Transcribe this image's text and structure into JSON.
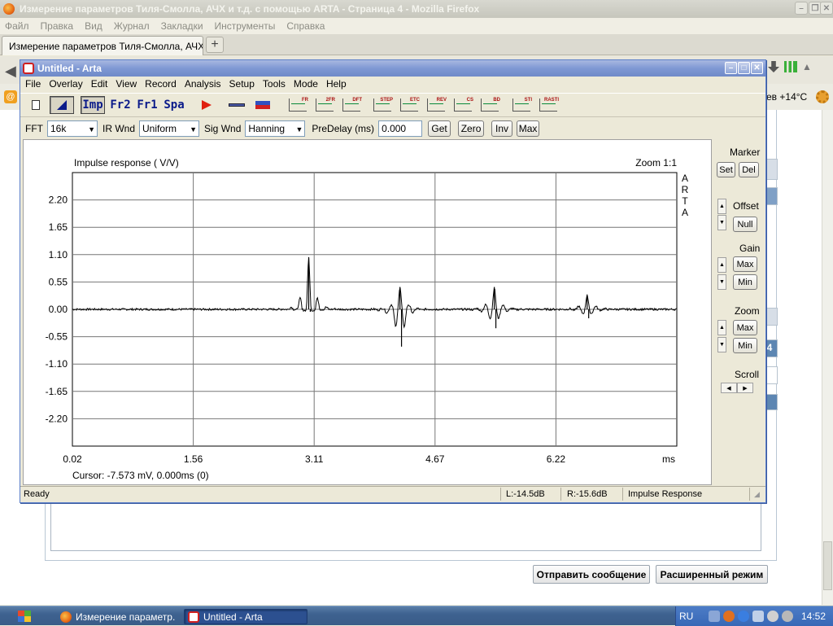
{
  "firefox": {
    "title": "Измерение параметров Тиля-Смолла, АЧХ и т.д. с помощью ARTA - Страница 4 - Mozilla Firefox",
    "menu": [
      "Файл",
      "Правка",
      "Вид",
      "Журнал",
      "Закладки",
      "Инструменты",
      "Справка"
    ],
    "tab_title": "Измерение параметров Тиля-Смолла, АЧХ...",
    "new_tab": "+",
    "weather": "ев +14°C",
    "side_label_4": "4",
    "buttons": {
      "send": "Отправить сообщение",
      "advanced": "Расширенный режим"
    }
  },
  "arta": {
    "title": "Untitled - Arta",
    "menu": [
      "File",
      "Overlay",
      "Edit",
      "View",
      "Record",
      "Analysis",
      "Setup",
      "Tools",
      "Mode",
      "Help"
    ],
    "toolbar": {
      "imp": "Imp",
      "fr2": "Fr2",
      "fr1": "Fr1",
      "spa": "Spa",
      "mini_labels": [
        "FR",
        "2FR",
        "DFT",
        "STEP",
        "ETC",
        "REV",
        "CS",
        "BD",
        "STI",
        "RASTI"
      ]
    },
    "params": {
      "fft_label": "FFT",
      "fft_value": "16k",
      "ir_wnd_label": "IR Wnd",
      "ir_wnd_value": "Uniform",
      "sig_wnd_label": "Sig Wnd",
      "sig_wnd_value": "Hanning",
      "predelay_label": "PreDelay (ms)",
      "predelay_value": "0.000",
      "get": "Get",
      "zero": "Zero",
      "inv": "Inv",
      "max": "Max"
    },
    "side": {
      "marker": "Marker",
      "set": "Set",
      "del": "Del",
      "offset": "Offset",
      "null": "Null",
      "gain": "Gain",
      "gain_max": "Max",
      "gain_min": "Min",
      "zoom": "Zoom",
      "zoom_max": "Max",
      "zoom_min": "Min",
      "scroll": "Scroll"
    },
    "cursor_text": "Cursor: -7.573 mV, 0.000ms (0)",
    "status": {
      "ready": "Ready",
      "left": "L:-14.5dB",
      "right": "R:-15.6dB",
      "mode": "Impulse Response"
    }
  },
  "chart_data": {
    "type": "line",
    "title": "Impulse response ( V/V)",
    "zoom_label": "Zoom 1:1",
    "watermark": [
      "A",
      "R",
      "T",
      "A"
    ],
    "xlabel": "ms",
    "x_ticks": [
      "0.02",
      "1.56",
      "3.11",
      "4.67",
      "6.22"
    ],
    "y_ticks": [
      "2.20",
      "1.65",
      "1.10",
      "0.55",
      "0.00",
      "-0.55",
      "-1.10",
      "-1.65",
      "-2.20"
    ],
    "xlim": [
      0.02,
      7.77
    ],
    "ylim": [
      -2.75,
      2.75
    ],
    "grid": true,
    "series": [
      {
        "color": "#000000",
        "noise_level": 0.02,
        "impulses": [
          {
            "x": 3.05,
            "peak": 1.05,
            "trough": -0.05
          },
          {
            "x": 4.22,
            "peak": 0.45,
            "trough": -0.75
          },
          {
            "x": 5.43,
            "peak": 0.45,
            "trough": -0.38
          },
          {
            "x": 6.62,
            "peak": 0.3,
            "trough": -0.18
          }
        ]
      }
    ]
  },
  "taskbar": {
    "items": [
      "Измерение параметр...",
      "Untitled - Arta"
    ],
    "lang": "RU",
    "clock": "14:52"
  }
}
